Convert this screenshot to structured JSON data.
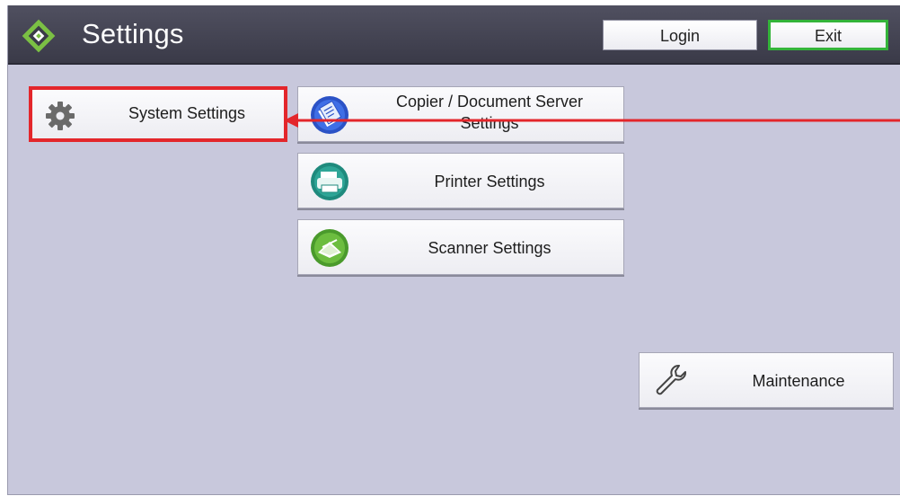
{
  "header": {
    "title": "Settings",
    "logo_icon": "settings-diamond-logo",
    "login_label": "Login",
    "exit_label": "Exit"
  },
  "tiles": [
    {
      "id": "system",
      "label": "System Settings",
      "icon": "gear-icon",
      "highlighted": true
    },
    {
      "id": "copier",
      "label": "Copier / Document Server Settings",
      "icon": "copier-icon"
    },
    {
      "id": "printer",
      "label": "Printer Settings",
      "icon": "printer-icon"
    },
    {
      "id": "scanner",
      "label": "Scanner Settings",
      "icon": "scanner-icon"
    },
    {
      "id": "maintenance",
      "label": "Maintenance",
      "icon": "wrench-icon"
    }
  ],
  "annotation": {
    "type": "arrow",
    "color": "#e3262b",
    "points_to": "System Settings"
  },
  "colors": {
    "header_bg": "#3a3a48",
    "panel_bg": "#c8c8dc",
    "highlight": "#e3262b",
    "exit_border": "#34b43a"
  }
}
